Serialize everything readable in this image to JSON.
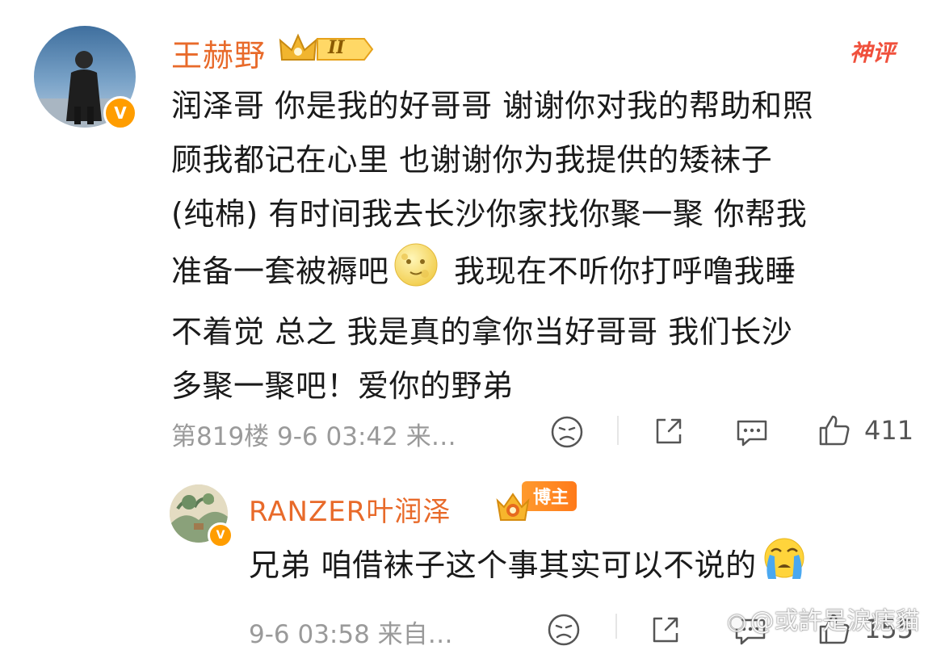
{
  "comment": {
    "author": "王赫野",
    "level_badge": "II",
    "tag": "神评",
    "text_lines": [
      "润泽哥 你是我的好哥哥 谢谢你对我的帮助和照",
      "顾我都记在心里 也谢谢你为我提供的矮袜子",
      "(纯棉) 有时间我去长沙你家找你聚一聚 你帮我",
      "准备一套被褥吧",
      " 我现在不听你打呼噜我睡",
      "不着觉 总之 我是真的拿你当好哥哥 我们长沙",
      "多聚一聚吧！爱你的野弟"
    ],
    "meta": "第819楼 9-6 03:42 来…",
    "like_count": "411"
  },
  "reply": {
    "author": "RANZER叶润泽",
    "role_badge": "博主",
    "text": "兄弟 咱借袜子这个事其实可以不说的",
    "meta": "9-6 03:58 来自…",
    "like_count": "155"
  },
  "watermark": "@或許是淚痣貓",
  "verified_badge": "V",
  "colors": {
    "name": "#e86a2a",
    "meta": "#9a9a9a",
    "badge": "#ff9d00",
    "shenping": "#f0503c"
  },
  "icons": [
    "dislike-face-icon",
    "share-icon",
    "comment-icon",
    "thumbs-up-icon",
    "moon-face-emoji",
    "crying-emoji",
    "crown-icon"
  ]
}
